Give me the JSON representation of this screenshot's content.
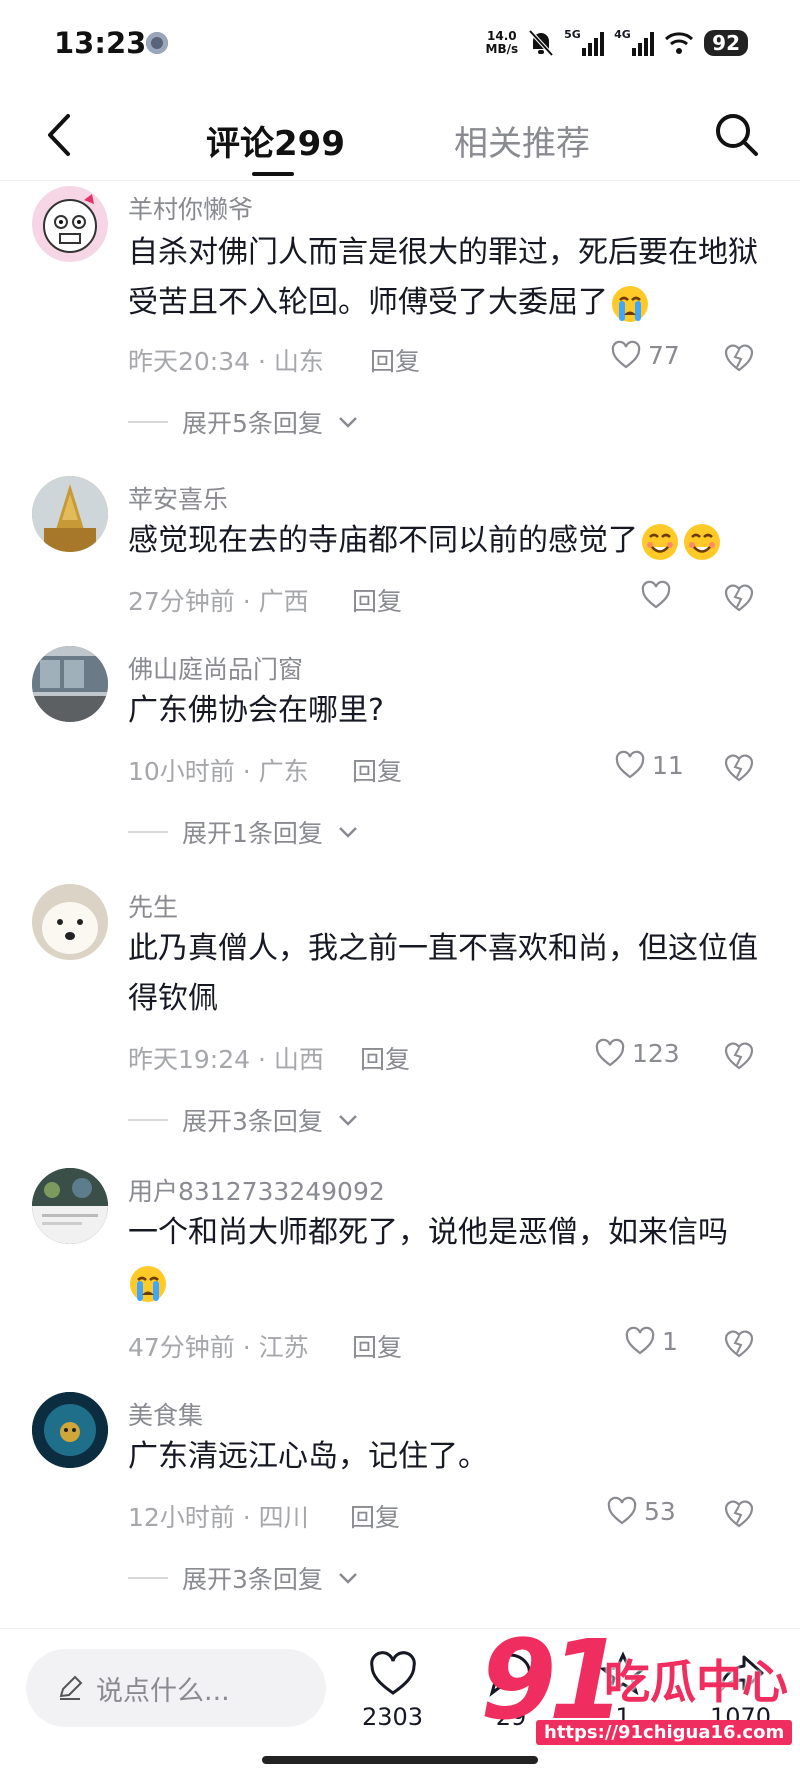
{
  "status": {
    "time": "13:23",
    "speed_top": "14.0",
    "speed_bottom": "MB/s",
    "net1": "5G",
    "net2": "4G",
    "battery": "92"
  },
  "header": {
    "tab_comments": "评论299",
    "tab_related": "相关推荐"
  },
  "comments": [
    {
      "name": "羊村你懒爷",
      "text": "自杀对佛门人而言是很大的罪过，死后要在地狱受苦且不入轮回。师傅受了大委屈了",
      "time": "昨天20:34",
      "region": "山东",
      "reply": "回复",
      "likes": "77",
      "expand": "展开5条回复"
    },
    {
      "name": "苹安喜乐",
      "text": "感觉现在去的寺庙都不同以前的感觉了",
      "time": "27分钟前",
      "region": "广西",
      "reply": "回复",
      "likes": "",
      "expand": ""
    },
    {
      "name": "佛山庭尚品门窗",
      "text": "广东佛协会在哪里?",
      "time": "10小时前",
      "region": "广东",
      "reply": "回复",
      "likes": "11",
      "expand": "展开1条回复"
    },
    {
      "name": "先生",
      "text": "此乃真僧人，我之前一直不喜欢和尚，但这位值得钦佩",
      "time": "昨天19:24",
      "region": "山西",
      "reply": "回复",
      "likes": "123",
      "expand": "展开3条回复"
    },
    {
      "name": "用户8312733249092",
      "text": "一个和尚大师都死了，说他是恶僧，如来信吗",
      "time": "47分钟前",
      "region": "江苏",
      "reply": "回复",
      "likes": "1",
      "expand": ""
    },
    {
      "name": "美食集",
      "text": "广东清远江心岛，记住了。",
      "time": "12小时前",
      "region": "四川",
      "reply": "回复",
      "likes": "53",
      "expand": "展开3条回复"
    }
  ],
  "bottom": {
    "placeholder": "说点什么...",
    "like_count": "2303",
    "comment_count": "29",
    "star_count": "1",
    "share_count": "1070"
  },
  "watermark": {
    "number": "91",
    "text": "吃瓜中心",
    "url": "https://91chigua16.com"
  },
  "colors": {
    "text": "#161823",
    "muted": "#8a8b91",
    "accent": "#ef2d5e"
  }
}
